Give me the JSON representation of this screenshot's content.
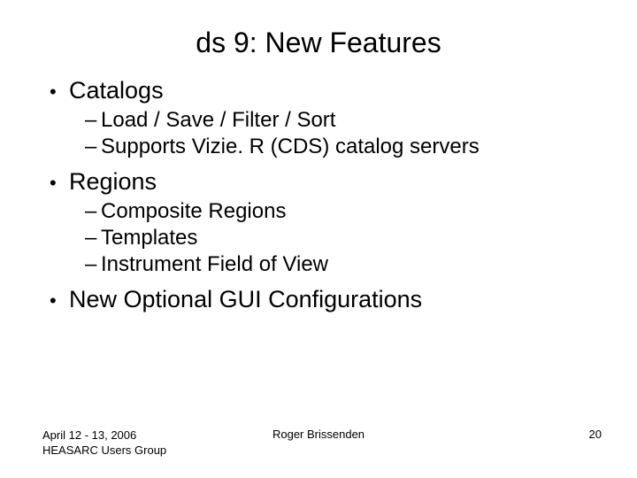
{
  "title": "ds 9: New Features",
  "bullets": [
    {
      "label": "Catalogs",
      "sub": [
        "Load / Save / Filter / Sort",
        "Supports Vizie. R (CDS) catalog servers"
      ]
    },
    {
      "label": "Regions",
      "sub": [
        "Composite Regions",
        "Templates",
        "Instrument Field of View"
      ]
    },
    {
      "label": "New Optional GUI Configurations",
      "sub": []
    }
  ],
  "footer": {
    "date": "April 12 - 13, 2006",
    "group": "HEASARC Users Group",
    "author": "Roger Brissenden",
    "page": "20"
  }
}
